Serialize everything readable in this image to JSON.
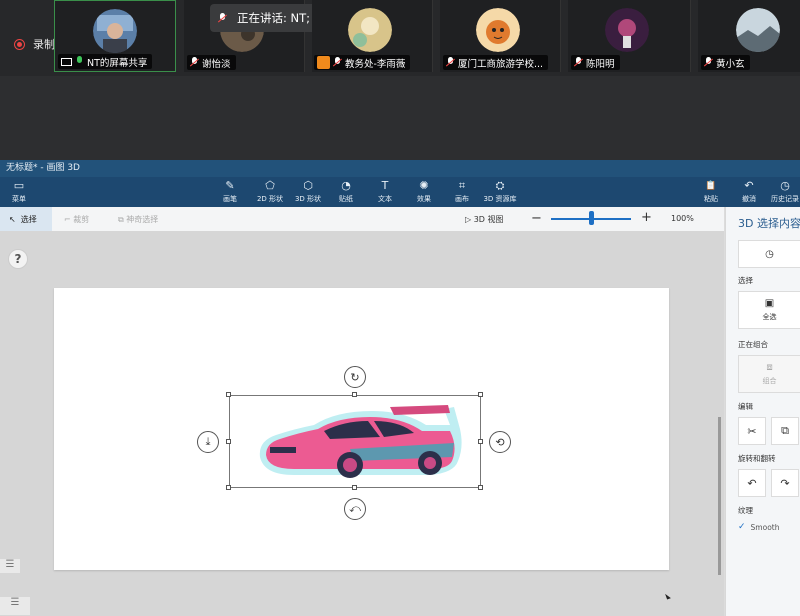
{
  "meeting": {
    "recording_label": "录制中",
    "speaking_prefix": "正在讲话: ",
    "speaking_name": "NT;",
    "participants": [
      {
        "name": "NT的屏幕共享",
        "mic": "on",
        "sharing": true
      },
      {
        "name": "谢怡淡",
        "mic": "muted"
      },
      {
        "name": "教务处-李雨薇",
        "mic": "muted"
      },
      {
        "name": "厦门工商旅游学校...",
        "mic": "muted"
      },
      {
        "name": "陈阳明",
        "mic": "muted"
      },
      {
        "name": "黄小玄",
        "mic": "muted"
      }
    ]
  },
  "app": {
    "window_title": "无标题* - 画图 3D",
    "menu_label": "菜单",
    "tools": [
      {
        "icon": "brush-icon",
        "glyph": "✎",
        "label": "画笔"
      },
      {
        "icon": "2d-shapes-icon",
        "glyph": "⬠",
        "label": "2D 形状"
      },
      {
        "icon": "3d-shapes-icon",
        "glyph": "⬡",
        "label": "3D 形状"
      },
      {
        "icon": "sticker-icon",
        "glyph": "◔",
        "label": "贴纸"
      },
      {
        "icon": "text-icon",
        "glyph": "T",
        "label": "文本"
      },
      {
        "icon": "effects-icon",
        "glyph": "✺",
        "label": "效果"
      },
      {
        "icon": "canvas-icon",
        "glyph": "⌗",
        "label": "画布"
      },
      {
        "icon": "3d-library-icon",
        "glyph": "⛭",
        "label": "3D 资源库"
      }
    ],
    "right_tools": [
      {
        "icon": "paste-icon",
        "glyph": "📋",
        "label": "粘贴"
      },
      {
        "icon": "undo-icon",
        "glyph": "↶",
        "label": "撤消"
      },
      {
        "icon": "history-icon",
        "glyph": "◷",
        "label": "历史记录"
      }
    ],
    "toolbar": {
      "select_label": "选择",
      "crop_label": "裁剪",
      "magic_select_label": "神奇选择",
      "view_3d_label": "3D 视图",
      "zoom_percent": "100%"
    },
    "panel": {
      "title": "3D 选择内容",
      "select_section": "选择",
      "select_all": "全选",
      "group_section": "正在组合",
      "group_button": "组合",
      "edit_section": "编辑",
      "rotate_section": "旋转和翻转",
      "texture_section": "纹理",
      "texture_option": "Smooth"
    },
    "side_menu_glyph": "☰",
    "help_glyph": "?"
  }
}
